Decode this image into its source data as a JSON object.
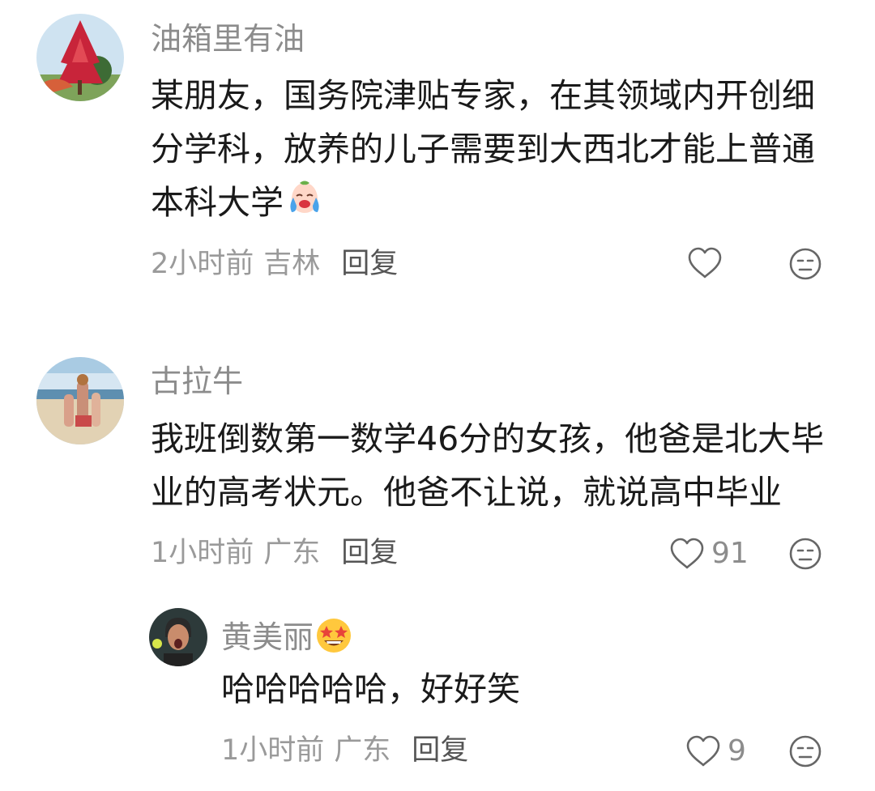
{
  "comments": [
    {
      "username": "油箱里有油",
      "lines": [
        "某朋友，国务院津贴专家，在其领域内开创细",
        "分学科，放养的儿子需要到大西北才能上普通",
        "本科大学"
      ],
      "emoji": "crying-face-emoji",
      "time": "2小时前",
      "location": "吉林",
      "reply_label": "回复",
      "like_count": ""
    },
    {
      "username": "古拉牛",
      "lines": [
        "我班倒数第一数学46分的女孩，他爸是北大毕",
        "业的高考状元。他爸不让说，就说高中毕业"
      ],
      "time": "1小时前",
      "location": "广东",
      "reply_label": "回复",
      "like_count": "91"
    },
    {
      "username": "黄美丽",
      "username_emoji": "star-struck-emoji",
      "lines": [
        "哈哈哈哈哈，好好笑"
      ],
      "time": "1小时前",
      "location": "广东",
      "reply_label": "回复",
      "like_count": "9"
    }
  ],
  "icons": {
    "like": "heart-outline-icon",
    "dislike": "unamused-face-icon"
  },
  "colors": {
    "text": "#1a1a1a",
    "username": "#8c8c8c",
    "meta": "#9a9a9a",
    "reply": "#555555",
    "icon": "#666666"
  }
}
